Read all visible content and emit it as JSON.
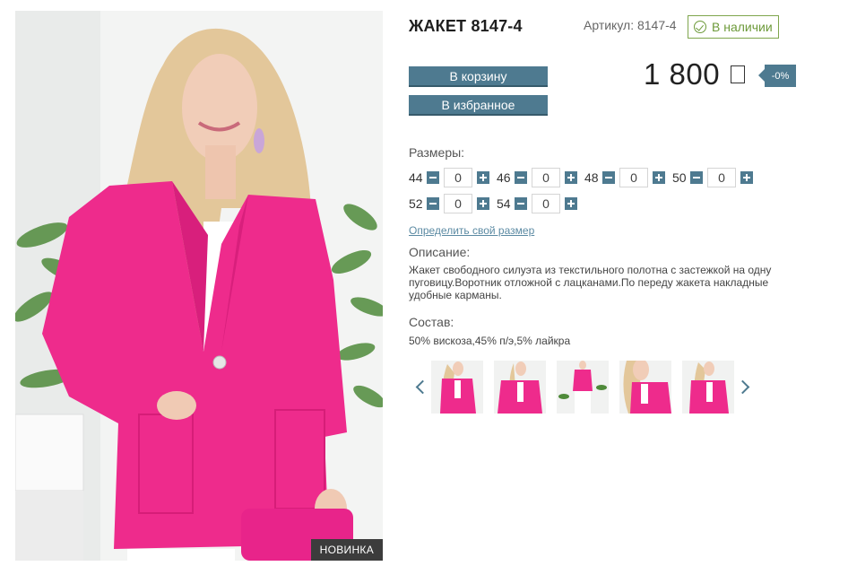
{
  "product": {
    "title": "ЖАКЕТ 8147-4",
    "sku_text": "Артикул: 8147-4",
    "stock_text": "В наличии",
    "price": "1 800",
    "discount": "-0%",
    "badge": "НОВИНКА",
    "color": "#ee2b8c"
  },
  "actions": {
    "cart_label": "В корзину",
    "favorite_label": "В избранное"
  },
  "sizes": {
    "label": "Размеры:",
    "items": [
      {
        "size": "44",
        "qty": "0"
      },
      {
        "size": "46",
        "qty": "0"
      },
      {
        "size": "48",
        "qty": "0"
      },
      {
        "size": "50",
        "qty": "0"
      },
      {
        "size": "52",
        "qty": "0"
      },
      {
        "size": "54",
        "qty": "0"
      }
    ],
    "link": "Определить свой размер"
  },
  "description": {
    "label": "Описание:",
    "text": "Жакет свободного силуэта из текстильного полотна с застежкой на одну пуговицу.Воротник отложной с лацканами.По переду жакета накладные удобные карманы."
  },
  "composition": {
    "label": "Состав:",
    "text": "50% вискоза,45% п/э,5% лайкра"
  },
  "gallery": {
    "thumbnails": [
      "thumb-1",
      "thumb-2",
      "thumb-3",
      "thumb-4",
      "thumb-5"
    ]
  },
  "colors": {
    "accent": "#4e7a90",
    "in_stock": "#6d9a3a",
    "jacket": "#ee2b8c"
  }
}
